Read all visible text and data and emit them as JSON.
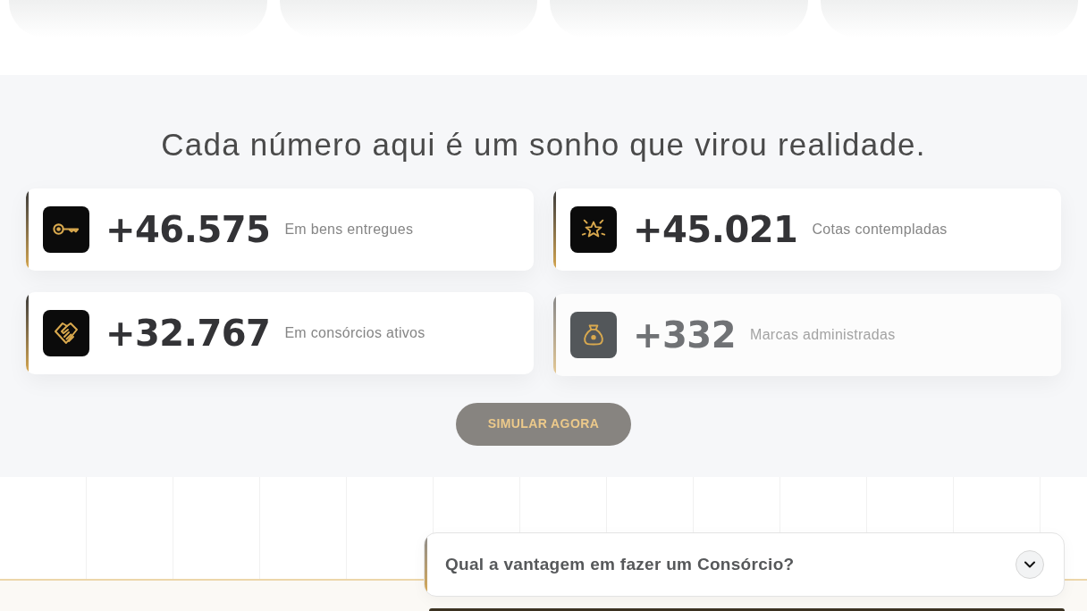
{
  "heading": "Cada número aqui é um sonho que virou realidade.",
  "stats": [
    {
      "value": "+46.575",
      "label": "Em bens entregues",
      "dimmed": false
    },
    {
      "value": "+45.021",
      "label": "Cotas contempladas",
      "dimmed": false
    },
    {
      "value": "+32.767",
      "label": "Em consórcios ativos",
      "dimmed": false
    },
    {
      "value": "+332",
      "label": "Marcas administradas",
      "dimmed": true
    }
  ],
  "cta": {
    "label": "SIMULAR AGORA"
  },
  "faq": [
    {
      "question": "Qual a vantagem em fazer um Consórcio?",
      "expanded": false
    }
  ]
}
